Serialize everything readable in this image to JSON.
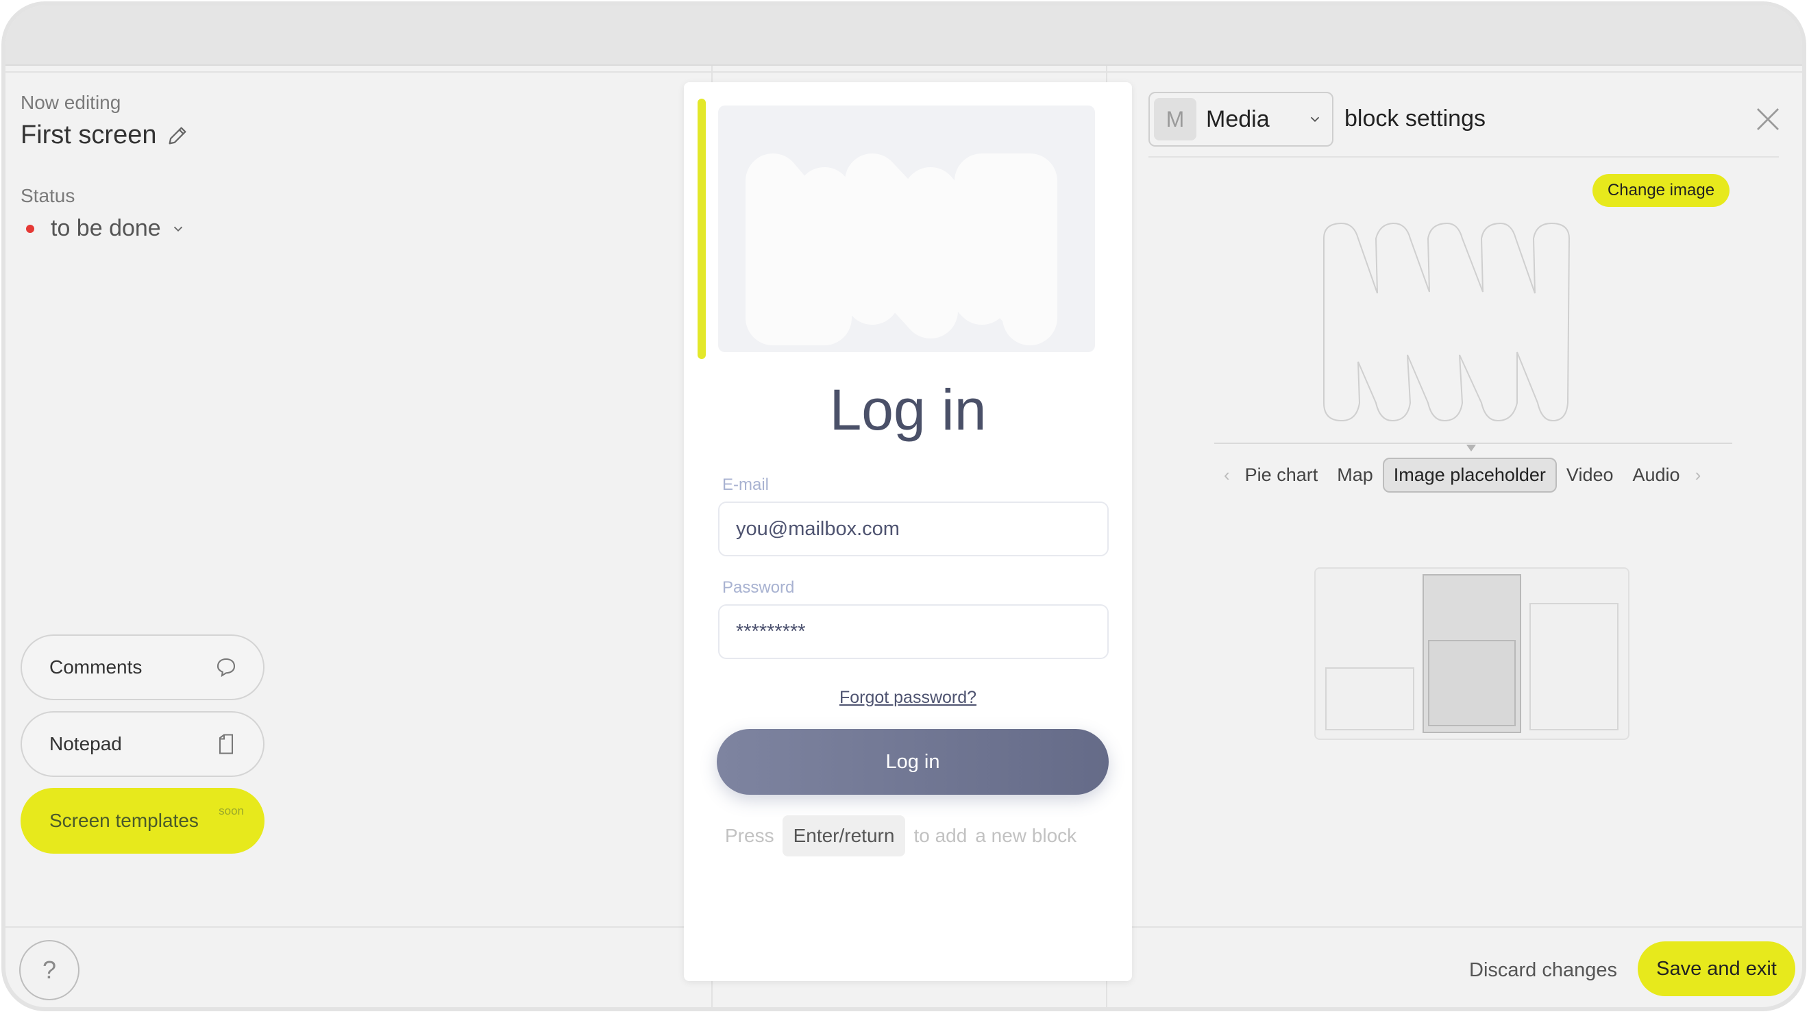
{
  "left_panel": {
    "now_editing_label": "Now editing",
    "screen_name": "First screen",
    "status_label": "Status",
    "status_value": "to be done",
    "status_color": "#e53935",
    "buttons": {
      "comments": "Comments",
      "notepad": "Notepad",
      "screen_templates": "Screen templates",
      "soon_badge": "soon"
    },
    "help_label": "?"
  },
  "canvas": {
    "title": "Log in",
    "email_label": "E-mail",
    "email_value": "you@mailbox.com",
    "password_label": "Password",
    "password_value": "*********",
    "forgot_link": "Forgot password?",
    "login_button": "Log in",
    "hint": {
      "press": "Press",
      "key": "Enter/return",
      "to_add": "to add",
      "new_block": "a new block"
    }
  },
  "right_panel": {
    "block_badge": "M",
    "block_type": "Media",
    "title": "block settings",
    "change_image_button": "Change image",
    "tabs": [
      "Pie chart",
      "Map",
      "Image placeholder",
      "Video",
      "Audio"
    ],
    "active_tab": "Image placeholder"
  },
  "footer": {
    "discard": "Discard changes",
    "save": "Save and exit"
  },
  "colors": {
    "accent": "#e7e91c",
    "button_primary": "#6f7590",
    "text_heading": "#4a5068"
  }
}
